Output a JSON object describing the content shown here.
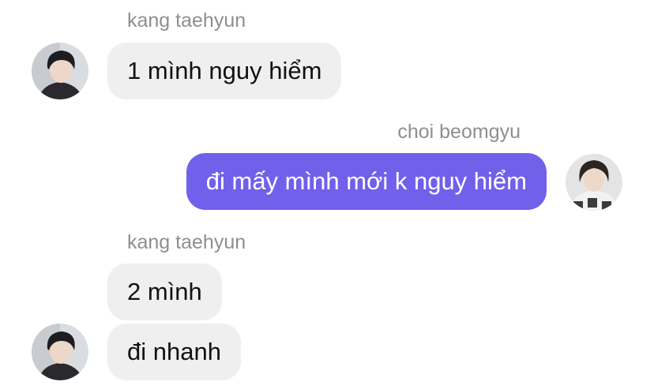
{
  "messages": [
    {
      "sender": "kang taehyun",
      "text": "1 mình nguy hiểm",
      "direction": "incoming",
      "avatar": "user-avatar-kang-taehyun"
    },
    {
      "sender": "choi beomgyu",
      "text": "đi mấy mình mới k nguy hiểm",
      "direction": "outgoing",
      "avatar": "user-avatar-choi-beomgyu"
    },
    {
      "sender": "kang taehyun",
      "texts": [
        "2 mình",
        "đi nhanh"
      ],
      "direction": "incoming",
      "avatar": "user-avatar-kang-taehyun"
    }
  ],
  "colors": {
    "incoming_bubble": "#efeff0",
    "outgoing_bubble": "#7160ea",
    "sender_label": "#8e8e93"
  }
}
